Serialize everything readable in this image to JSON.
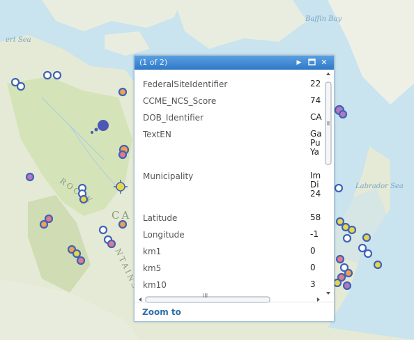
{
  "map": {
    "labels": {
      "baffin": "Baffin Bay",
      "sea_nw": "ert Sea",
      "labrador": "Labrador Sea",
      "rocky": "ROCKY",
      "ca": "CA",
      "ntains": "NTAINS"
    },
    "colors": {
      "ocean": "#c9e3ef",
      "land": "#e7ecd9",
      "land_green": "#d3e2b5",
      "marker_blue": "#3f63b8",
      "marker_orange": "#f0a050",
      "marker_yellow": "#e8d64a",
      "marker_pink": "#e27a8c"
    }
  },
  "popup": {
    "title": "(1 of 2)",
    "icons": {
      "next": "play-icon",
      "maximize": "maximize-icon",
      "close": "close-icon"
    },
    "fields": [
      {
        "name": "FederalSiteIdentifier",
        "value": "22"
      },
      {
        "name": "CCME_NCS_Score",
        "value": "74"
      },
      {
        "name": "DOB_Identifier",
        "value": "CA"
      },
      {
        "name": "TextEN",
        "value": "Ga\nPu\nYa"
      },
      {
        "name": "Municipality",
        "value": "Im\nDi\n24"
      },
      {
        "name": "Latitude",
        "value": "58"
      },
      {
        "name": "Longitude",
        "value": "-1"
      },
      {
        "name": "km1",
        "value": "0"
      },
      {
        "name": "km5",
        "value": "0"
      },
      {
        "name": "km10",
        "value": "3"
      }
    ],
    "zoom_label": "Zoom to",
    "hscroll_thumb": "III"
  }
}
